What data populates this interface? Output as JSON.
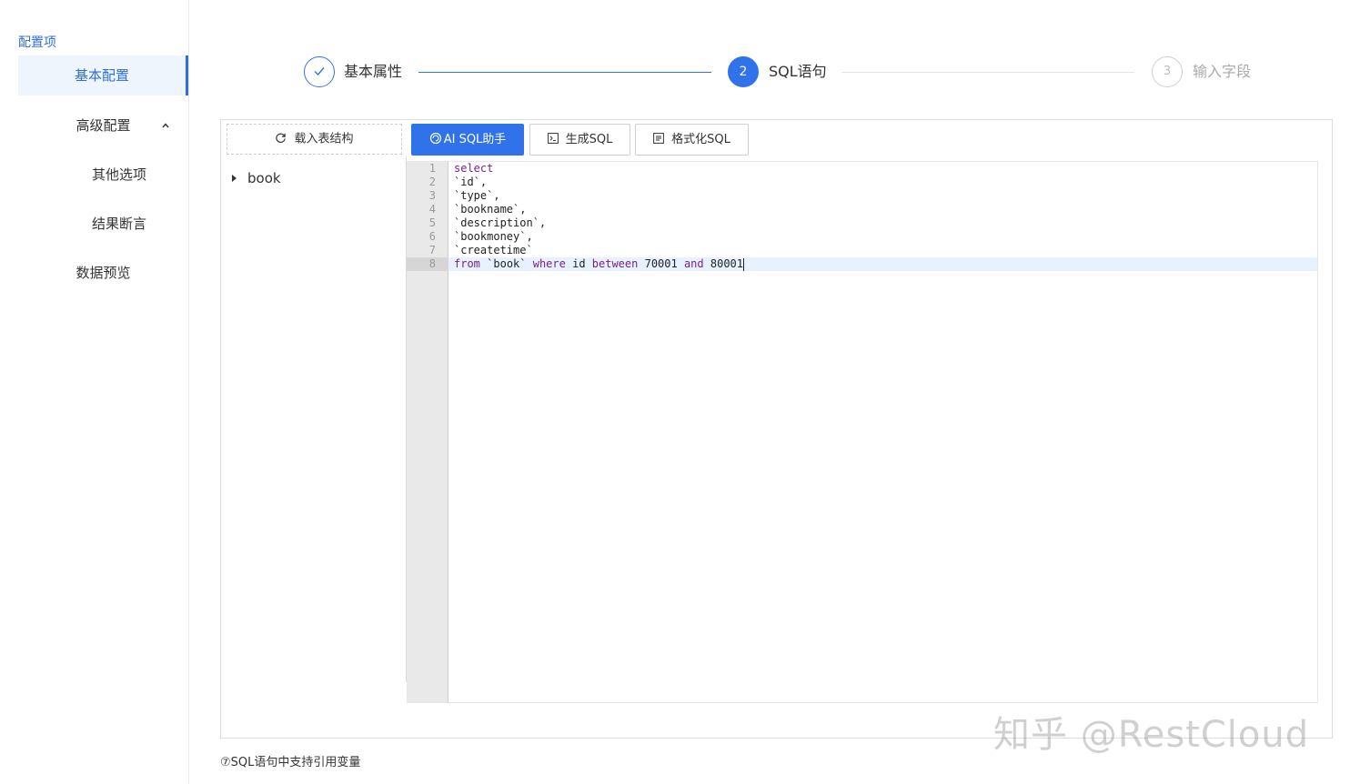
{
  "sidebar": {
    "title": "配置项",
    "items": [
      {
        "label": "基本配置"
      },
      {
        "label": "高级配置"
      },
      {
        "label": "其他选项"
      },
      {
        "label": "结果断言"
      },
      {
        "label": "数据预览"
      }
    ]
  },
  "steps": [
    {
      "number": "1",
      "label": "基本属性",
      "status": "done"
    },
    {
      "number": "2",
      "label": "SQL语句",
      "status": "active"
    },
    {
      "number": "3",
      "label": "输入字段",
      "status": "pending"
    }
  ],
  "tree": {
    "load_button": "载入表结构",
    "items": [
      "book"
    ]
  },
  "toolbar": {
    "ai_label": "AI SQL助手",
    "generate_label": "生成SQL",
    "format_label": "格式化SQL"
  },
  "editor": {
    "line_numbers": [
      "1",
      "2",
      "3",
      "4",
      "5",
      "6",
      "7",
      "8"
    ],
    "lines": [
      "select",
      "`id`,",
      "`type`,",
      "`bookname`,",
      "`description`,",
      "`bookmoney`,",
      "`createtime`",
      "from `book` where id between 70001 and 80001"
    ]
  },
  "hint": "⑦SQL语句中支持引用变量",
  "watermark": "知乎 @RestCloud",
  "colors": {
    "accent": "#2f72ea",
    "keyword": "#7a1f8a"
  }
}
